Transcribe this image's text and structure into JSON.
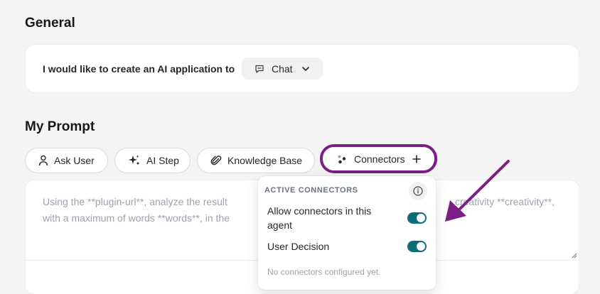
{
  "general": {
    "title": "General",
    "create_label": "I would like to create an AI application to",
    "app_type": "Chat"
  },
  "prompt": {
    "title": "My Prompt",
    "tools": [
      {
        "label": "Ask User",
        "icon": "person-icon"
      },
      {
        "label": "AI Step",
        "icon": "sparkle-icon"
      },
      {
        "label": "Knowledge Base",
        "icon": "paperclip-icon"
      },
      {
        "label": "Connectors",
        "icon": "connectors-icon"
      }
    ],
    "text_left": "Using the **plugin-url**, analyze the result",
    "text_right": "creativity **creativity**,",
    "text_line2_left": "with a maximum of words **words**, in the"
  },
  "connectors_menu": {
    "header": "ACTIVE CONNECTORS",
    "rows": [
      {
        "label": "Allow connectors in this agent",
        "enabled": true
      },
      {
        "label": "User Decision",
        "enabled": true
      }
    ],
    "empty_text": "No connectors configured yet."
  },
  "colors": {
    "highlight": "#7b1f86",
    "toggle_on": "#0e6b78"
  }
}
